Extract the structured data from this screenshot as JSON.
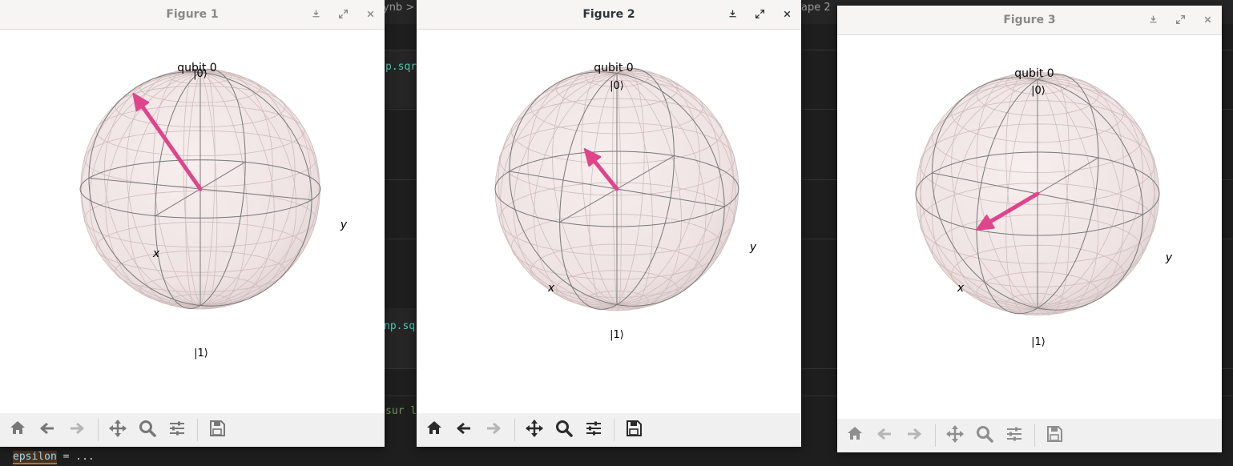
{
  "editor": {
    "tab_fragment_left": "ynb >",
    "tab_fragment_right": "ape 2",
    "code_fragment_1": "p.sqrt",
    "code_fragment_2": "np.sqr",
    "comment_fragment": "sur le",
    "bottom_line": {
      "token": "epsilon",
      "rest": " = ..."
    }
  },
  "windows": [
    {
      "title": "Figure 1",
      "active": false,
      "plot_title": "qubit 0",
      "labels": {
        "zero": "|0⟩",
        "one": "|1⟩",
        "x": "x",
        "y": "y"
      },
      "state_vector": {
        "x": 0.25,
        "y": -0.5,
        "z": 0.83
      }
    },
    {
      "title": "Figure 2",
      "active": true,
      "plot_title": "qubit 0",
      "labels": {
        "zero": "|0⟩",
        "one": "|1⟩",
        "x": "x",
        "y": "y"
      },
      "state_vector": {
        "x": 0.0,
        "y": -0.3,
        "z": 0.3
      }
    },
    {
      "title": "Figure 3",
      "active": false,
      "plot_title": "qubit 0",
      "labels": {
        "zero": "|0⟩",
        "one": "|1⟩",
        "x": "x",
        "y": "y"
      },
      "state_vector": {
        "x": 1.0,
        "y": 0.0,
        "z": 0.0
      }
    }
  ],
  "toolbar_icons": [
    "home-icon",
    "back-arrow-icon",
    "forward-arrow-icon",
    "pan-move-icon",
    "zoom-magnifier-icon",
    "configure-subplots-icon",
    "save-floppy-icon"
  ],
  "titlebar_icons": [
    "download-icon",
    "maximize-icon",
    "close-icon"
  ],
  "colors": {
    "vector": "#e0448b",
    "sphere_fill": "#f3e6e6",
    "wire": "#7a7a7a",
    "editor_bg": "#1e1e1e",
    "code_func": "#4ec9b0",
    "code_comment": "#6a9955",
    "code_var": "#9cdcfe"
  }
}
